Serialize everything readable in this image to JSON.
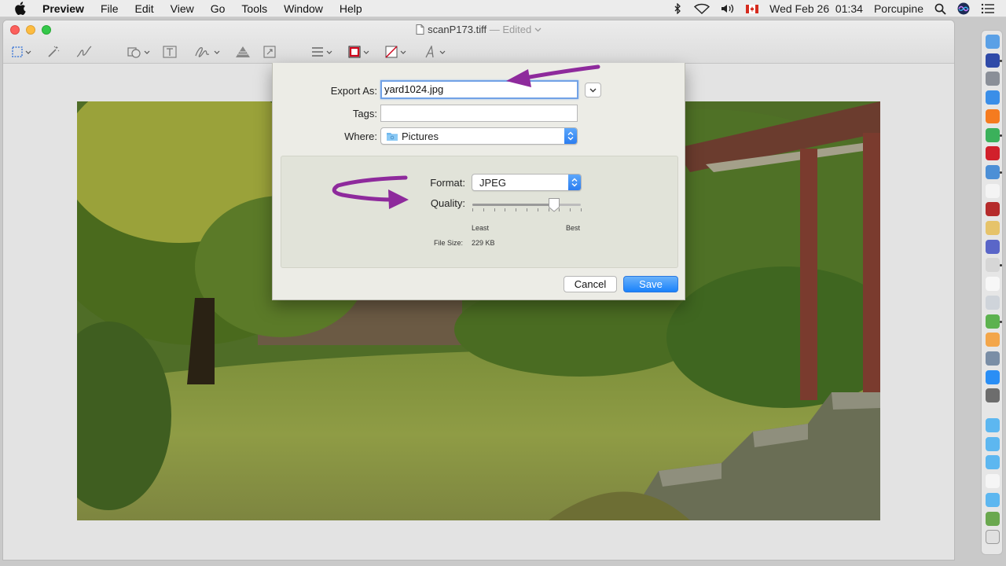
{
  "menubar": {
    "app_name": "Preview",
    "items": [
      "File",
      "Edit",
      "View",
      "Go",
      "Tools",
      "Window",
      "Help"
    ],
    "datetime": "Wed Feb 26  01:34",
    "user": "Porcupine",
    "status_icons": [
      "bluetooth-icon",
      "wifi-icon",
      "volume-icon",
      "canada-flag-icon",
      "search-icon",
      "siri-icon",
      "list-icon"
    ]
  },
  "window": {
    "title_file": "scanP173.tiff",
    "title_status": "— Edited",
    "toolbar_icons": [
      "rect-select-icon",
      "instant-alpha-icon",
      "sketch-icon",
      "shapes-icon",
      "text-icon",
      "sign-icon",
      "adjust-color-icon",
      "adjust-size-icon",
      "shape-style-icon",
      "border-color-icon",
      "fill-color-icon",
      "text-style-icon"
    ]
  },
  "export_dialog": {
    "export_as_label": "Export As:",
    "export_as_value": "yard1024.jpg",
    "tags_label": "Tags:",
    "tags_value": "",
    "where_label": "Where:",
    "where_value": "Pictures",
    "format_label": "Format:",
    "format_value": "JPEG",
    "quality_label": "Quality:",
    "quality_level": 0.75,
    "quality_min_label": "Least",
    "quality_max_label": "Best",
    "file_size_label": "File Size:",
    "file_size_value": "229 KB",
    "cancel_label": "Cancel",
    "save_label": "Save"
  },
  "colors": {
    "accent_blue": "#2a82fb",
    "annotation_purple": "#8e2a9c",
    "traffic_close": "#fc605c",
    "traffic_min": "#fdbc40",
    "traffic_max": "#34c84a"
  },
  "dock": {
    "icons": [
      "finder-icon",
      "siri-icon",
      "launchpad-icon",
      "safari-icon",
      "firefox-icon",
      "chrome-icon",
      "opera-icon",
      "preview-icon",
      "calendar-icon",
      "dictionary-icon",
      "notes-icon",
      "pixelmator-icon",
      "system-icon",
      "textedit-icon",
      "scanner-icon",
      "maps-icon",
      "photos-icon",
      "image-capture-icon",
      "app-store-icon",
      "system-preferences-icon",
      "folder-icon",
      "folder-icon",
      "folder-icon",
      "document-icon",
      "folder-icon",
      "image-icon",
      "trash-icon"
    ]
  }
}
